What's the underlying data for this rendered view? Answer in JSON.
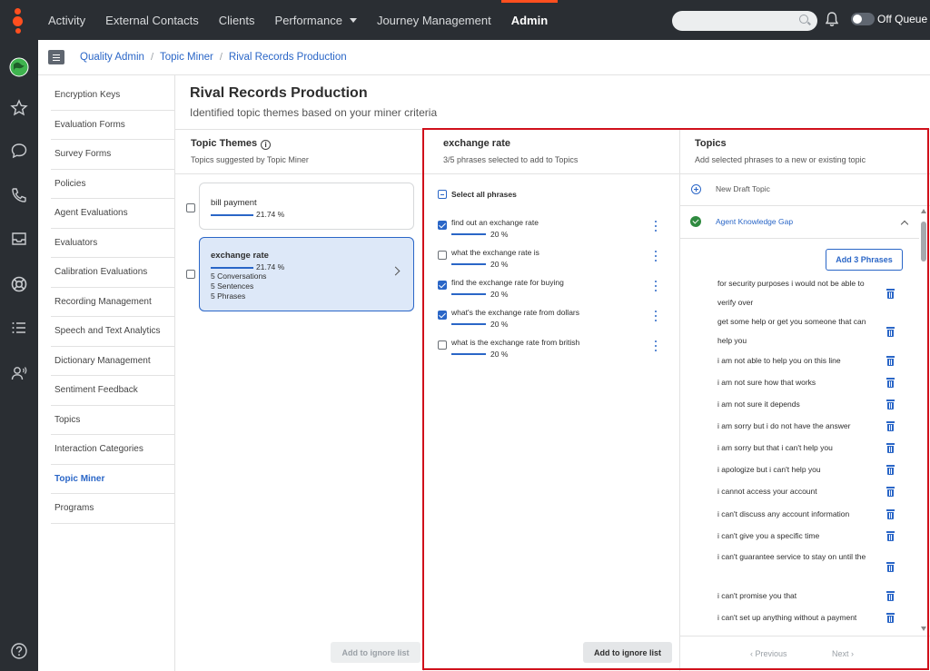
{
  "topnav": {
    "items": [
      {
        "label": "Activity"
      },
      {
        "label": "External Contacts"
      },
      {
        "label": "Clients"
      },
      {
        "label": "Performance"
      },
      {
        "label": "Journey Management"
      },
      {
        "label": "Admin"
      }
    ],
    "search_placeholder": "",
    "queue_toggle_label": "Off Queue"
  },
  "breadcrumb": [
    "Quality Admin",
    "Topic Miner",
    "Rival Records Production"
  ],
  "admin_nav": [
    "Encryption Keys",
    "Evaluation Forms",
    "Survey Forms",
    "Policies",
    "Agent Evaluations",
    "Evaluators",
    "Calibration Evaluations",
    "Recording Management",
    "Speech and Text Analytics",
    "Dictionary Management",
    "Sentiment Feedback",
    "Topics",
    "Interaction Categories",
    "Topic Miner",
    "Programs"
  ],
  "page": {
    "title": "Rival Records Production",
    "subtitle": "Identified topic themes based on your miner criteria"
  },
  "themes": {
    "title": "Topic Themes",
    "subtitle": "Topics suggested by Topic Miner",
    "items": [
      {
        "name": "bill payment",
        "pct": "21.74 %",
        "fill": 0.2174
      },
      {
        "name": "exchange rate",
        "pct": "21.74 %",
        "fill": 0.2174,
        "conversations": "5 Conversations",
        "sentences": "5 Sentences",
        "phrases": "5 Phrases"
      }
    ],
    "ignore_label": "Add to ignore list"
  },
  "phrases": {
    "title": "exchange rate",
    "subtitle": "3/5 phrases selected to add to Topics",
    "select_all_label": "Select all phrases",
    "items": [
      {
        "text": "find out an exchange rate",
        "pct": "20 %",
        "checked": true
      },
      {
        "text": "what the exchange rate is",
        "pct": "20 %",
        "checked": false
      },
      {
        "text": "find the exchange rate for buying",
        "pct": "20 %",
        "checked": true
      },
      {
        "text": "what's the exchange rate from dollars",
        "pct": "20 %",
        "checked": true
      },
      {
        "text": "what is the exchange rate from british",
        "pct": "20 %",
        "checked": false
      }
    ],
    "ignore_label": "Add to ignore list"
  },
  "topics": {
    "title": "Topics",
    "subtitle": "Add selected phrases to a new or existing topic",
    "new_draft_label": "New Draft Topic",
    "topic_name": "Agent Knowledge Gap",
    "add_button_label": "Add 3 Phrases",
    "phrases": [
      "for security purposes i would not be able to verify over",
      "get some help or get you someone that can help you",
      "i am not able to help you on this line",
      "i am not sure how that works",
      "i am not sure it depends",
      "i am sorry but i do not have the answer",
      "i am sorry but that i can't help you",
      "i apologize but i can't help you",
      "i cannot access your account",
      "i can't discuss any account information",
      "i can't give you a specific time",
      "i can't guarantee service to stay on until the",
      "i can't promise you that",
      "i can't set up anything without a payment"
    ],
    "prev_label": "Previous",
    "next_label": "Next"
  }
}
